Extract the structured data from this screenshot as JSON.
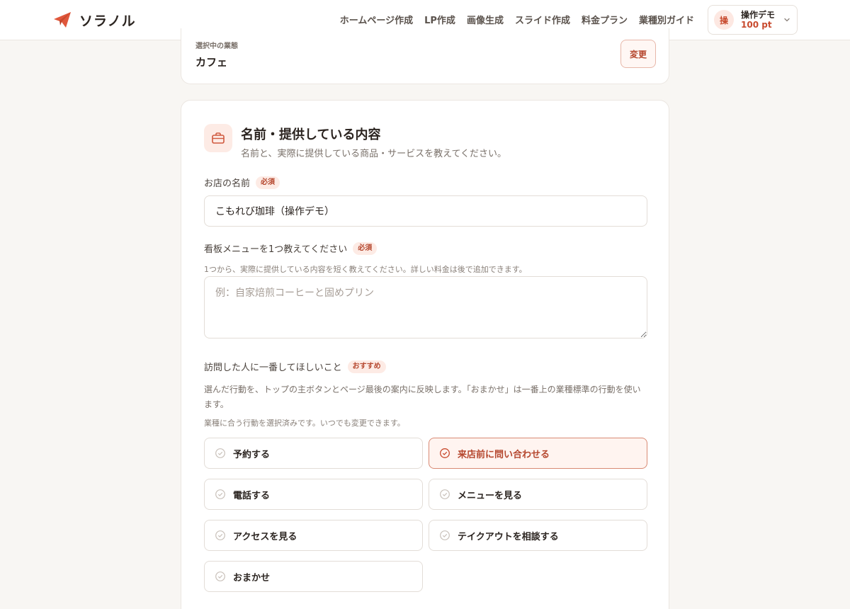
{
  "header": {
    "brand_name": "ソラノル",
    "nav": [
      "ホームページ作成",
      "LP作成",
      "画像生成",
      "スライド作成",
      "料金プラン",
      "業種別ガイド"
    ],
    "account": {
      "avatar_char": "操",
      "name": "操作デモ",
      "points": "100 pt"
    }
  },
  "business": {
    "label": "選択中の業態",
    "value": "カフェ",
    "change_label": "変更"
  },
  "section": {
    "title": "名前・提供している内容",
    "subtitle": "名前と、実際に提供している商品・サービスを教えてください。"
  },
  "shop_name": {
    "label": "お店の名前",
    "badge": "必須",
    "value": "こもれび珈琲（操作デモ）"
  },
  "signature_menu": {
    "label": "看板メニューを1つ教えてください",
    "badge": "必須",
    "hint": "1つから、実際に提供している内容を短く教えてください。詳しい料金は後で追加できます。",
    "placeholder": "例：自家焙煎コーヒーと固めプリン"
  },
  "visitor_action": {
    "label": "訪問した人に一番してほしいこと",
    "badge": "おすすめ",
    "description": "選んだ行動を、トップの主ボタンとページ最後の案内に反映します。「おまかせ」は一番上の業種標準の行動を使います。",
    "note": "業種に合う行動を選択済みです。いつでも変更できます。",
    "options": [
      {
        "label": "予約する",
        "selected": false
      },
      {
        "label": "来店前に問い合わせる",
        "selected": true
      },
      {
        "label": "電話する",
        "selected": false
      },
      {
        "label": "メニューを見る",
        "selected": false
      },
      {
        "label": "アクセスを見る",
        "selected": false
      },
      {
        "label": "テイクアウトを相談する",
        "selected": false
      },
      {
        "label": "おまかせ",
        "selected": false
      }
    ]
  },
  "colors": {
    "accent": "#e0573b",
    "accent_dark": "#b5472e",
    "accent_bg": "#fdebe5"
  }
}
